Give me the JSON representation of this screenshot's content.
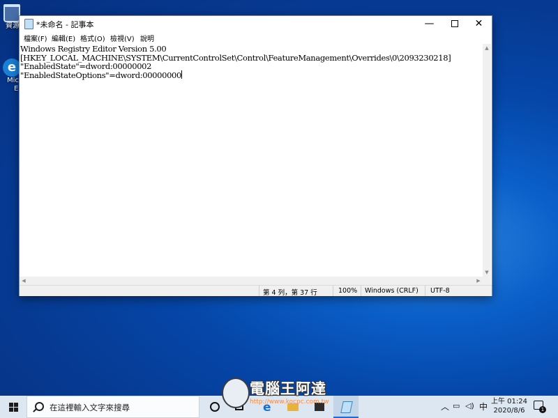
{
  "desktop": {
    "recycle_bin_label": "資源",
    "edge_label_line1": "Mic",
    "edge_label_line2": "E"
  },
  "window": {
    "title": "*未命名 - 記事本",
    "minimize_glyph": "—",
    "close_glyph": "✕"
  },
  "menu": {
    "file": "檔案(F)",
    "edit": "編輯(E)",
    "format": "格式(O)",
    "view": "檢視(V)",
    "help": "說明"
  },
  "editor": {
    "lines": [
      "Windows Registry Editor Version 5.00",
      "[HKEY_LOCAL_MACHINE\\SYSTEM\\CurrentControlSet\\Control\\FeatureManagement\\Overrides\\0\\2093230218]",
      "\"EnabledState\"=dword:00000002",
      "\"EnabledStateOptions\"=dword:00000000"
    ]
  },
  "status": {
    "position": "第 4 列，第 37 行",
    "zoom": "100%",
    "line_ending": "Windows (CRLF)",
    "encoding": "UTF-8"
  },
  "watermark": {
    "title": "電腦王阿達",
    "url": "http://www.kocpc.com.tw"
  },
  "taskbar": {
    "search_placeholder": "在這裡輸入文字來搜尋",
    "ime": "中",
    "time": "上午 01:24",
    "date": "2020/8/6",
    "notification_count": "1",
    "tray_chevron": "︿"
  }
}
